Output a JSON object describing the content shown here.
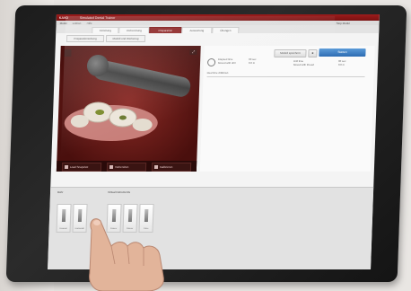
{
  "app": {
    "title": "Simulated Dental Trainer",
    "brand": "KAVO",
    "accent": "#8b2222"
  },
  "menu": {
    "items": [
      "Modul",
      "Lektion",
      "Hilfe"
    ],
    "right": [
      "Stop Modul"
    ]
  },
  "tabs": [
    "Einleitung",
    "Vorbereitung",
    "Präparation",
    "Auswertung",
    "Übungen"
  ],
  "subtabs": [
    "Präparationsübung",
    "Modell und Werkzeug"
  ],
  "viewport": {
    "buttons": [
      "Load Snapshot",
      "Vorbereiten",
      "Kalibrieren"
    ]
  },
  "rightpane": {
    "top_button": "Modell speichern",
    "primary_button": "Starten",
    "info_left": [
      "Elapsed time",
      "Moved with drill"
    ],
    "info_left_values": [
      "00 sec",
      "0.0 m"
    ],
    "info_right": [
      "Drill time",
      "Moved with thread"
    ],
    "info_right_values": [
      "00 sec",
      "0.0 m"
    ],
    "status_line": "Real time drilldown"
  },
  "lower": {
    "left_label": "Bohr",
    "mid_label": "Virtual Instruments",
    "tiles": [
      {
        "label": "Diamant"
      },
      {
        "label": "Hartmetall"
      },
      {
        "label": "Finierer"
      },
      {
        "label": "Polierer"
      },
      {
        "label": "Fräse"
      }
    ]
  },
  "icons": {
    "viewport_corner": "expand-icon",
    "clock": "clock-icon",
    "snapshot": "camera-icon"
  }
}
